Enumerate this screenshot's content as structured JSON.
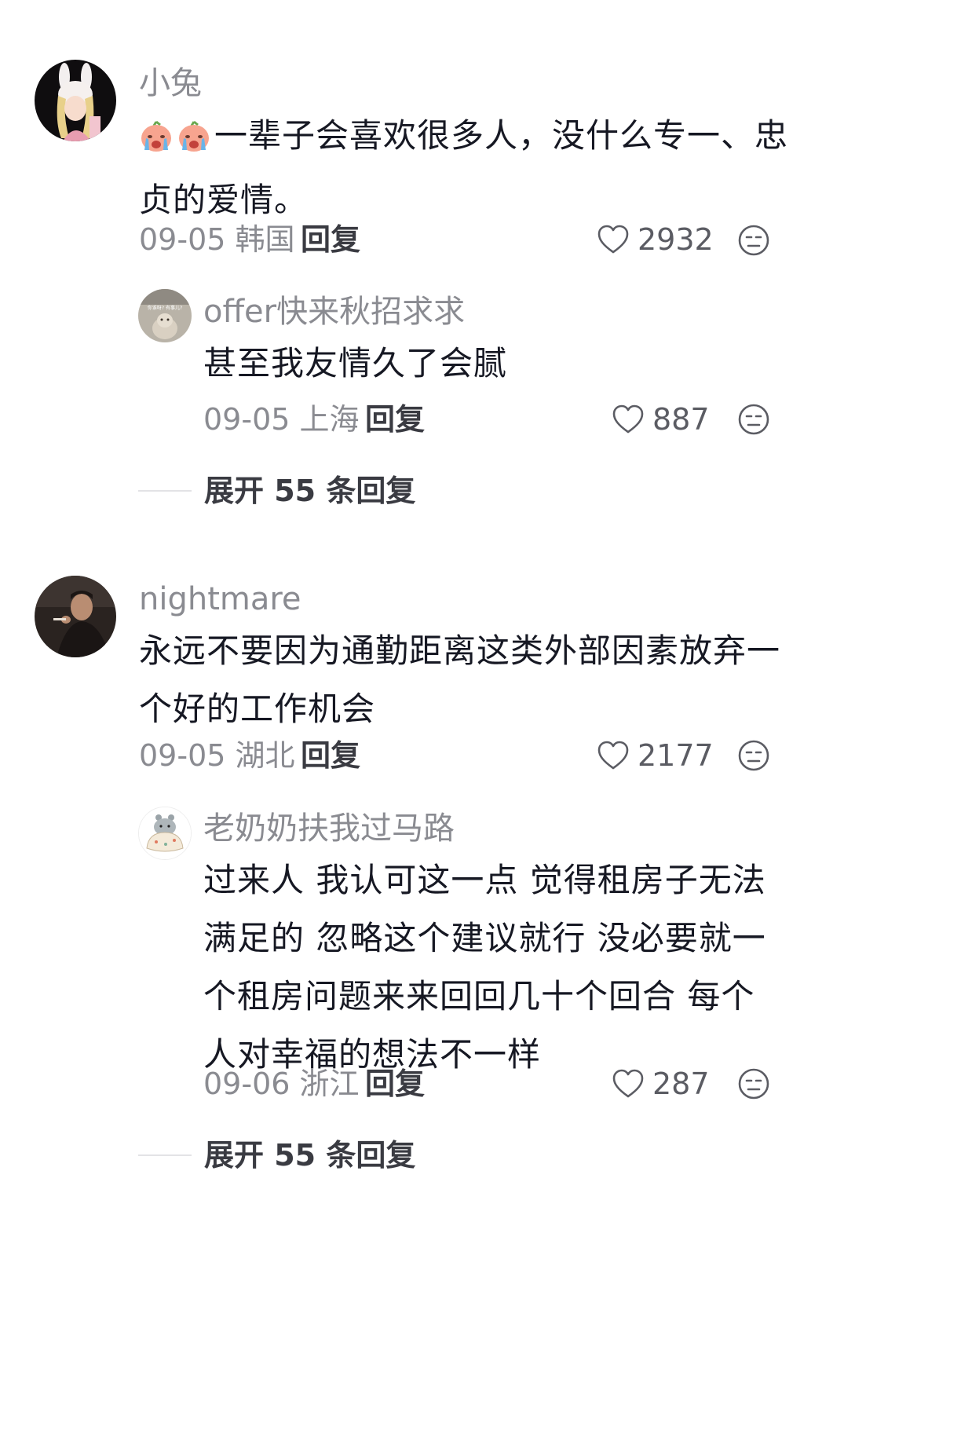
{
  "comments": [
    {
      "user": "小兔",
      "text": "一辈子会喜欢很多人，没什么专一、忠贞的爱情。",
      "emojis": [
        "crying-peach-emoji",
        "crying-peach-emoji"
      ],
      "date": "09-05",
      "location": "韩国",
      "reply_label": "回复",
      "likes": "2932",
      "replies": [
        {
          "user": "offer快来秋招求求",
          "avatar_caption": "你谁呀? 有事儿?",
          "text": "甚至我友情久了会腻",
          "date": "09-05",
          "location": "上海",
          "reply_label": "回复",
          "likes": "887"
        }
      ],
      "expand_label": "展开 55 条回复"
    },
    {
      "user": "nightmare",
      "text": "永远不要因为通勤距离这类外部因素放弃一个好的工作机会",
      "date": "09-05",
      "location": "湖北",
      "reply_label": "回复",
      "likes": "2177",
      "replies": [
        {
          "user": "老奶奶扶我过马路",
          "text": "过来人 我认可这一点 觉得租房子无法满足的 忽略这个建议就行 没必要就一个租房问题来来回回几十个回合 每个人对幸福的想法不一样",
          "date": "09-06",
          "location": "浙江",
          "reply_label": "回复",
          "likes": "287"
        }
      ],
      "expand_label": "展开 55 条回复"
    }
  ],
  "icons": {
    "like": "heart-outline-icon",
    "more": "neutral-face-icon"
  },
  "colors": {
    "text": "#161823",
    "secondary": "#8a8b91",
    "divider": "#e3e3e6"
  }
}
